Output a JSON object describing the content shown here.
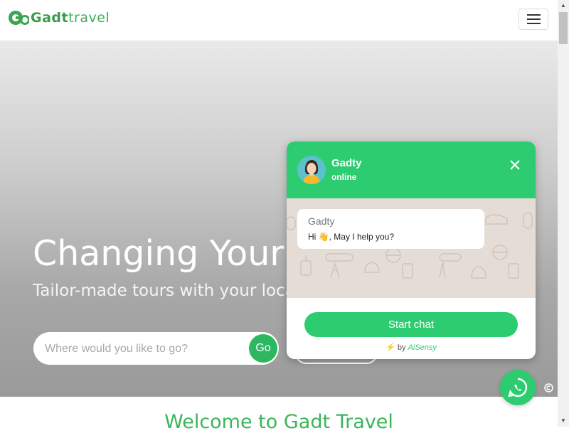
{
  "header": {
    "logo_mark": "Go",
    "logo_gadt": "Gadt",
    "logo_travel": "travel",
    "menu_icon": "hamburger-icon"
  },
  "hero": {
    "title": "Changing Your L",
    "subtitle": "Tailor-made tours with your local e",
    "search": {
      "placeholder": "Where would you like to go?",
      "button_label": "Go"
    }
  },
  "welcome": {
    "heading": "Welcome to Gadt Travel"
  },
  "chat": {
    "agent_name": "Gadty",
    "status": "online",
    "message_sender": "Gadty",
    "message_text": "Hi 👋, May I help you?",
    "start_label": "Start chat",
    "powered_prefix": "⚡",
    "powered_by": "by",
    "powered_brand": "AiSensy",
    "header_color": "#2ecc71"
  },
  "colors": {
    "brand_green": "#2cb760",
    "welcome_green": "#3cb55a"
  }
}
